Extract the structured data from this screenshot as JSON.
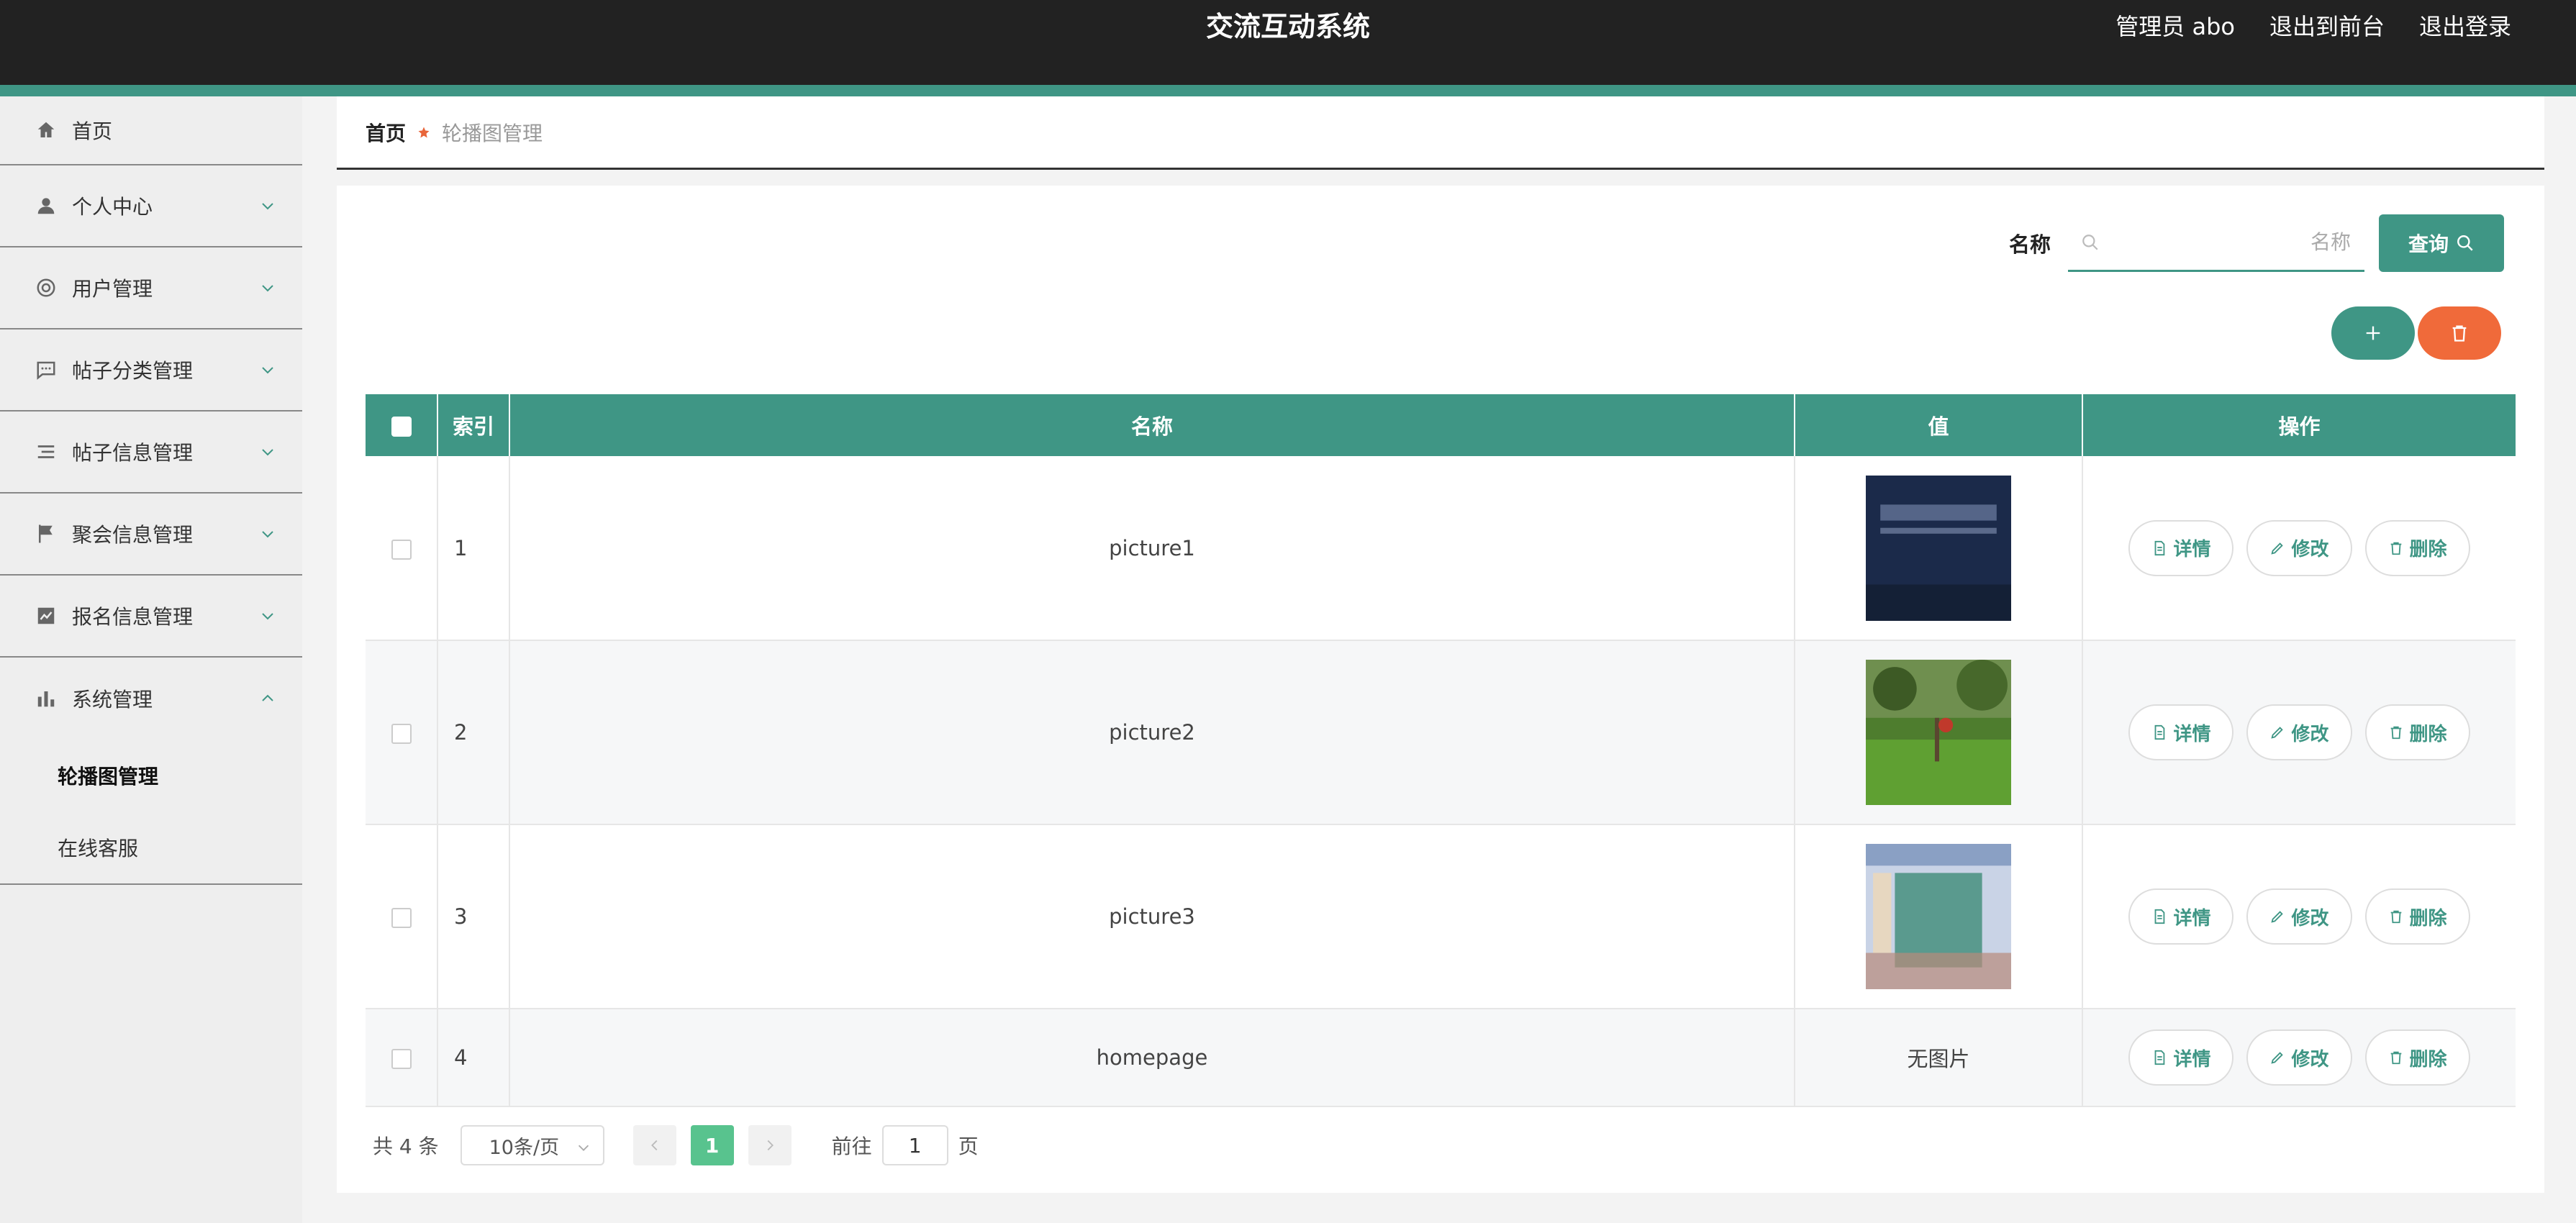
{
  "header": {
    "title": "交流互动系统",
    "admin": "管理员 abo",
    "to_front": "退出到前台",
    "logout": "退出登录"
  },
  "sidebar": {
    "items": [
      {
        "label": "首页",
        "icon": "home-icon"
      },
      {
        "label": "个人中心",
        "icon": "user-icon"
      },
      {
        "label": "用户管理",
        "icon": "lifebuoy-icon"
      },
      {
        "label": "帖子分类管理",
        "icon": "chat-icon"
      },
      {
        "label": "帖子信息管理",
        "icon": "list-icon"
      },
      {
        "label": "聚会信息管理",
        "icon": "flag-icon"
      },
      {
        "label": "报名信息管理",
        "icon": "chart-icon"
      },
      {
        "label": "系统管理",
        "icon": "bar-chart-icon"
      }
    ],
    "sub_items": [
      {
        "label": "轮播图管理",
        "active": true
      },
      {
        "label": "在线客服",
        "active": false
      }
    ]
  },
  "breadcrumb": {
    "home": "首页",
    "current": "轮播图管理"
  },
  "search": {
    "label": "名称",
    "placeholder": "名称",
    "value": "",
    "button": "查询"
  },
  "table": {
    "headers": {
      "index": "索引",
      "name": "名称",
      "value": "值",
      "ops": "操作"
    },
    "rows": [
      {
        "index": "1",
        "name": "picture1",
        "value": ""
      },
      {
        "index": "2",
        "name": "picture2",
        "value": ""
      },
      {
        "index": "3",
        "name": "picture3",
        "value": ""
      },
      {
        "index": "4",
        "name": "homepage",
        "value": "无图片"
      }
    ],
    "ops": {
      "detail": "详情",
      "edit": "修改",
      "delete": "删除"
    }
  },
  "pagination": {
    "total": "共 4 条",
    "page_size": "10条/页",
    "current_page": "1",
    "goto_prefix": "前往",
    "goto_value": "1",
    "goto_suffix": "页"
  },
  "colors": {
    "primary": "#3f9685",
    "danger": "#f06a3a",
    "page_active": "#58c38e"
  }
}
